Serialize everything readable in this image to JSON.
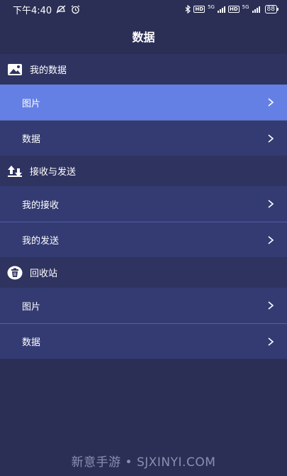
{
  "status_bar": {
    "time": "下午4:40",
    "battery": "88",
    "hd1": "HD",
    "net1": "5G",
    "hd2": "HD",
    "net2": "5G",
    "icons": [
      "mute-icon",
      "alarm-icon",
      "bluetooth-icon",
      "signal-icon",
      "battery-icon"
    ]
  },
  "header": {
    "title": "数据"
  },
  "sections": [
    {
      "title": "我的数据",
      "icon": "image-icon",
      "items": [
        {
          "label": "图片",
          "active": true
        },
        {
          "label": "数据",
          "active": false
        }
      ]
    },
    {
      "title": "接收与发送",
      "icon": "transfer-icon",
      "items": [
        {
          "label": "我的接收",
          "active": false
        },
        {
          "label": "我的发送",
          "active": false
        }
      ]
    },
    {
      "title": "回收站",
      "icon": "trash-icon",
      "items": [
        {
          "label": "图片",
          "active": false
        },
        {
          "label": "数据",
          "active": false
        }
      ]
    }
  ],
  "colors": {
    "background": "#2b2f55",
    "section_header": "#2f3360",
    "list_item": "#333b72",
    "active_item": "#6580e4"
  },
  "watermark": "新意手游 • SJXINYI.COM"
}
